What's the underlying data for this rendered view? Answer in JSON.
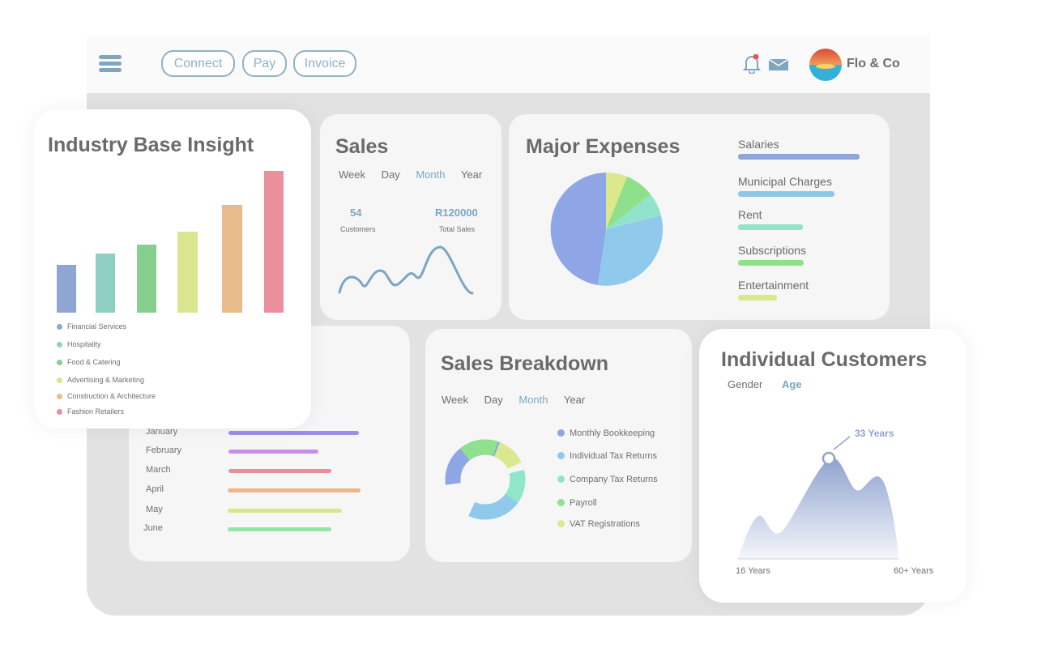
{
  "nav": {
    "buttons": [
      "Connect",
      "Pay",
      "Invoice"
    ],
    "brand": "Flo & Co",
    "notification_count": "1"
  },
  "industry": {
    "title": "Industry Base Insight",
    "legend": [
      "Financial Services",
      "Hospitality",
      "Food & Catering",
      "Advertising & Marketing",
      "Construction & Architecture",
      "Fashion Retailers"
    ],
    "colors": [
      "#8fa6d3",
      "#8fd0c2",
      "#86cf8f",
      "#d9e58f",
      "#e8bb8a",
      "#ec8f9c"
    ]
  },
  "sales": {
    "title": "Sales",
    "tabs": [
      "Week",
      "Day",
      "Month",
      "Year"
    ],
    "active_tab": "Month",
    "customers_value": "54",
    "customers_label": "Customers",
    "total_value": "R120000",
    "total_label": "Total Sales"
  },
  "expenses": {
    "title": "Major Expenses",
    "items": [
      {
        "label": "Salaries",
        "color": "#8fa6d8",
        "share": 1.0
      },
      {
        "label": "Municipal Charges",
        "color": "#8fc7e6",
        "share": 0.79
      },
      {
        "label": "Rent",
        "color": "#92e3cc",
        "share": 0.53
      },
      {
        "label": "Subscriptions",
        "color": "#8fe08a",
        "share": 0.54
      },
      {
        "label": "Entertainment",
        "color": "#dbe88c",
        "share": 0.32
      }
    ]
  },
  "monthly": {
    "rows": [
      {
        "label": "January",
        "color": "#9b8fe6"
      },
      {
        "label": "February",
        "color": "#c98fe6"
      },
      {
        "label": "March",
        "color": "#ea8f9a"
      },
      {
        "label": "April",
        "color": "#ecb58c"
      },
      {
        "label": "May",
        "color": "#d7e68c"
      },
      {
        "label": "June",
        "color": "#8fe6a6"
      }
    ]
  },
  "breakdown": {
    "title": "Sales Breakdown",
    "tabs": [
      "Week",
      "Day",
      "Month",
      "Year"
    ],
    "active_tab": "Month",
    "legend": [
      "Monthly Bookkeeping",
      "Individual Tax Returns",
      "Company Tax Returns",
      "Payroll",
      "VAT Registrations"
    ],
    "colors": [
      "#8fa6e6",
      "#8fc9ec",
      "#8fe6c9",
      "#8fe08f",
      "#dce88f"
    ]
  },
  "customers": {
    "title": "Individual Customers",
    "tabs": [
      "Gender",
      "Age"
    ],
    "active_tab": "Age",
    "peak_label": "33 Years",
    "x_start": "16 Years",
    "x_end": "60+ Years"
  }
}
